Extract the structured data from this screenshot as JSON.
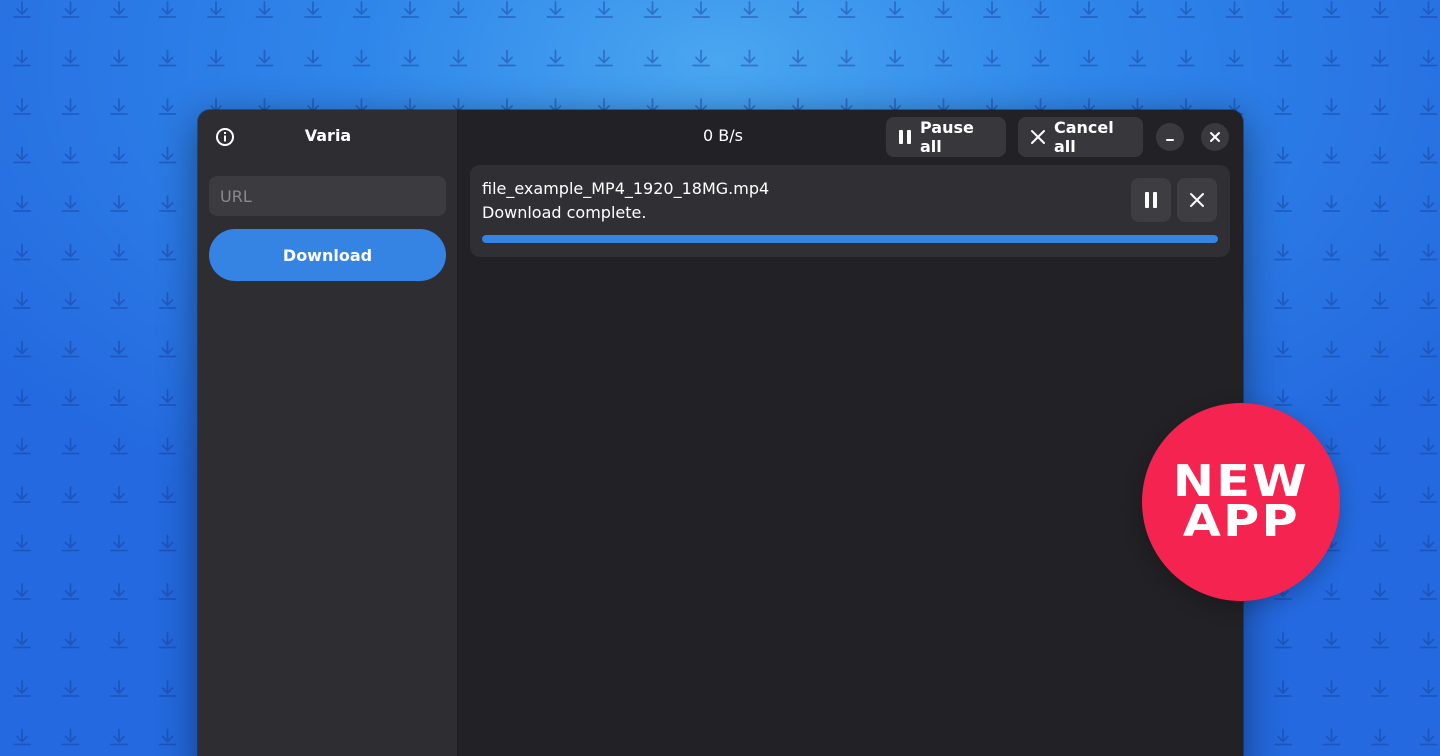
{
  "app": {
    "title": "Varia",
    "speed": "0 B/s"
  },
  "sidebar": {
    "url_placeholder": "URL",
    "download_label": "Download"
  },
  "header": {
    "pause_all_label": "Pause all",
    "cancel_all_label": "Cancel all"
  },
  "downloads": [
    {
      "filename": "file_example_MP4_1920_18MG.mp4",
      "status": "Download complete.",
      "progress": 1.0
    }
  ],
  "badge": {
    "line1": "NEW",
    "line2": "APP"
  },
  "colors": {
    "accent": "#3584e4",
    "badge": "#f5234f",
    "background": "#2f86ea"
  },
  "icons": {
    "info": "info-icon",
    "pause": "pause-icon",
    "close": "close-icon",
    "minimize": "minimize-icon",
    "background_pattern": "download-arrow-icon"
  }
}
